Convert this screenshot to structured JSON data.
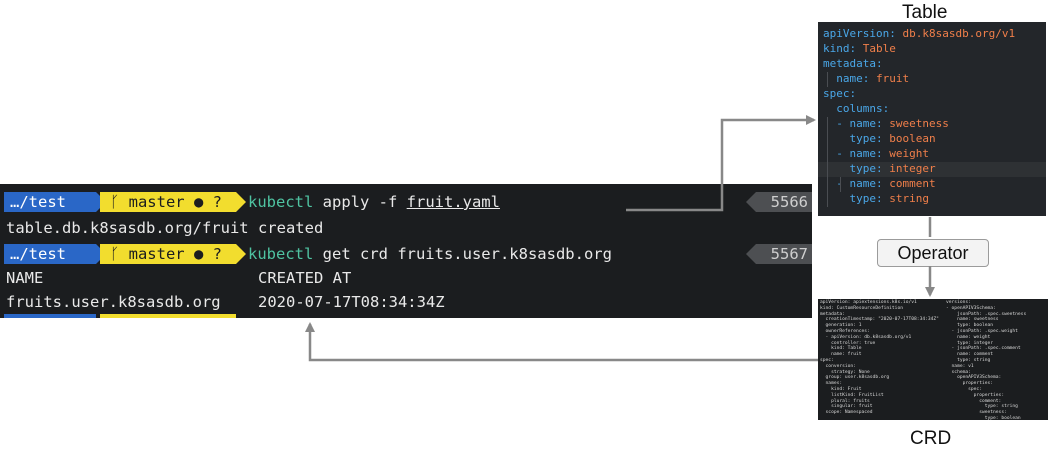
{
  "terminal": {
    "line1": {
      "dir": "…/test",
      "branch": "ᚴ master ● ?",
      "cmd_kw": "kubectl",
      "cmd_rest": " apply -f ",
      "cmd_file": "fruit.yaml",
      "hist": "5566"
    },
    "line2": {
      "output": "table.db.k8sasdb.org/fruit created"
    },
    "line3": {
      "dir": "…/test",
      "branch": "ᚴ master ● ?",
      "cmd_kw": "kubectl",
      "cmd_rest": " get crd fruits.user.k8sasdb.org",
      "hist": "5567"
    },
    "line4": {
      "col1": "NAME",
      "col2": "CREATED AT"
    },
    "line5": {
      "col1": "fruits.user.k8sasdb.org",
      "col2": "2020-07-17T08:34:34Z"
    }
  },
  "labels": {
    "table": "Table",
    "operator": "Operator",
    "crd": "CRD"
  },
  "yaml": [
    {
      "k": "apiVersion:",
      "v": " db.k8sasdb.org/v1",
      "indent": ""
    },
    {
      "k": "kind:",
      "v": " Table",
      "indent": ""
    },
    {
      "k": "metadata:",
      "v": "",
      "indent": ""
    },
    {
      "k": "name:",
      "v": " fruit",
      "indent": "  "
    },
    {
      "k": "spec:",
      "v": "",
      "indent": ""
    },
    {
      "k": "columns:",
      "v": "",
      "indent": "  "
    },
    {
      "k": "- name:",
      "v": " sweetness",
      "indent": "  "
    },
    {
      "k": "type:",
      "v": " boolean",
      "indent": "    "
    },
    {
      "k": "- name:",
      "v": " weight",
      "indent": "  "
    },
    {
      "k": "type:",
      "v": " integer",
      "indent": "    "
    },
    {
      "k": "- name:",
      "v": " comment",
      "indent": "  "
    },
    {
      "k": "type:",
      "v": " string",
      "indent": "    "
    }
  ],
  "crd_left": [
    "apiVersion: apiextensions.k8s.io/v1",
    "kind: CustomResourceDefinition",
    "metadata:",
    "  creationTimestamp: \"2020-07-17T08:34:34Z\"",
    "  generation: 1",
    "  ownerReferences:",
    "  - apiVersion: db.k8sasdb.org/v1",
    "    controller: true",
    "    kind: Table",
    "    name: fruit",
    "spec:",
    "  conversion:",
    "    strategy: None",
    "  group: user.k8sasdb.org",
    "  names:",
    "    kind: Fruit",
    "    listKind: FruitList",
    "    plural: fruits",
    "    singular: fruit",
    "  scope: Namespaced"
  ],
  "crd_right": [
    "versions:",
    "- openAPIV3Schema:",
    "    jsonPath: .spec.sweetness",
    "    name: sweetness",
    "    type: boolean",
    "  - jsonPath: .spec.weight",
    "    name: weight",
    "    type: integer",
    "  - jsonPath: .spec.comment",
    "    name: comment",
    "    type: string",
    "  name: v1",
    "  schema:",
    "    openAPIV3Schema:",
    "      properties:",
    "        spec:",
    "          properties:",
    "            comment:",
    "              type: string",
    "            sweetness:",
    "              type: boolean",
    "            weight:",
    "              type: integer",
    "          type: object",
    "      type: object",
    "  served: true",
    "  storage: true"
  ]
}
